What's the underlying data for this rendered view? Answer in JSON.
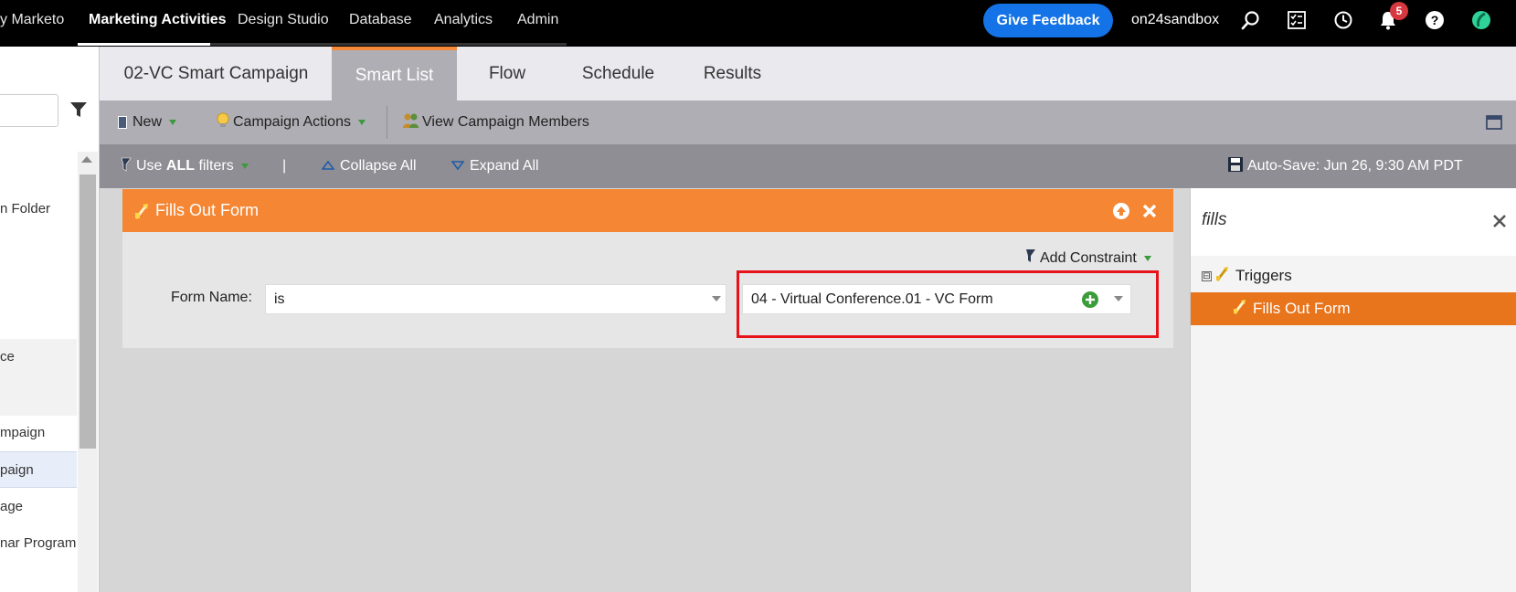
{
  "topnav": {
    "brand": "y Marketo",
    "items": [
      "Marketing Activities",
      "Design Studio",
      "Database",
      "Analytics",
      "Admin"
    ],
    "active_index": 0,
    "feedback_label": "Give Feedback",
    "account": "on24sandbox",
    "notification_count": "5",
    "icons": [
      "search-icon",
      "tasks-icon",
      "history-icon",
      "bell-icon",
      "help-icon",
      "marketo-logo-icon"
    ]
  },
  "left_panel": {
    "items": [
      {
        "label": "n Folder"
      },
      {
        "label": "ce"
      },
      {
        "label": "mpaign"
      },
      {
        "label": "paign"
      },
      {
        "label": "age"
      },
      {
        "label": "nar Program"
      }
    ]
  },
  "tabs": [
    {
      "label": "02-VC Smart Campaign"
    },
    {
      "label": "Smart List"
    },
    {
      "label": "Flow"
    },
    {
      "label": "Schedule"
    },
    {
      "label": "Results"
    }
  ],
  "toolbar": {
    "new_label": "New",
    "campaign_actions_label": "Campaign Actions",
    "view_members_label": "View Campaign Members"
  },
  "filterbar": {
    "use_prefix": "Use ",
    "use_bold": "ALL",
    "use_suffix": " filters",
    "separator": "|",
    "collapse_label": "Collapse All",
    "expand_label": "Expand All",
    "autosave_label": "Auto-Save: Jun 26, 9:30 AM PDT"
  },
  "filter_card": {
    "title": "Fills Out Form",
    "add_constraint_label": "Add Constraint",
    "field_label": "Form Name:",
    "operator_value": "is",
    "form_value": "04 - Virtual Conference.01 - VC Form"
  },
  "right_panel": {
    "search_text": "fills",
    "tree_group": "Triggers",
    "tree_item": "Fills Out Form",
    "expander": "⊟"
  },
  "colors": {
    "accent_orange": "#f58634",
    "selected_orange": "#e8741c",
    "feedback_blue": "#1473e6",
    "highlight_red": "#e8121b"
  }
}
